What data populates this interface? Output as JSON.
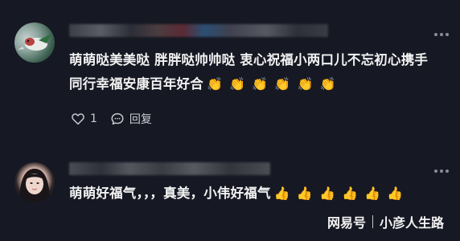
{
  "comments": [
    {
      "avatar": "bird-avatar",
      "text": "萌萌哒美美哒 胖胖哒帅帅哒 衷心祝福小两口儿不忘初心携手同行幸福安康百年好合",
      "emojis": [
        "👏",
        "👏",
        "👏",
        "👏",
        "👏",
        "👏"
      ],
      "like_count": "1",
      "reply_label": "回复"
    },
    {
      "avatar": "girl-avatar",
      "text": "萌萌好福气，，，真美，小伟好福气",
      "emojis": [
        "👍",
        "👍",
        "👍",
        "👍",
        "👍",
        "👍"
      ]
    }
  ],
  "watermark": {
    "brand": "网易号",
    "author": "小彦人生路"
  }
}
